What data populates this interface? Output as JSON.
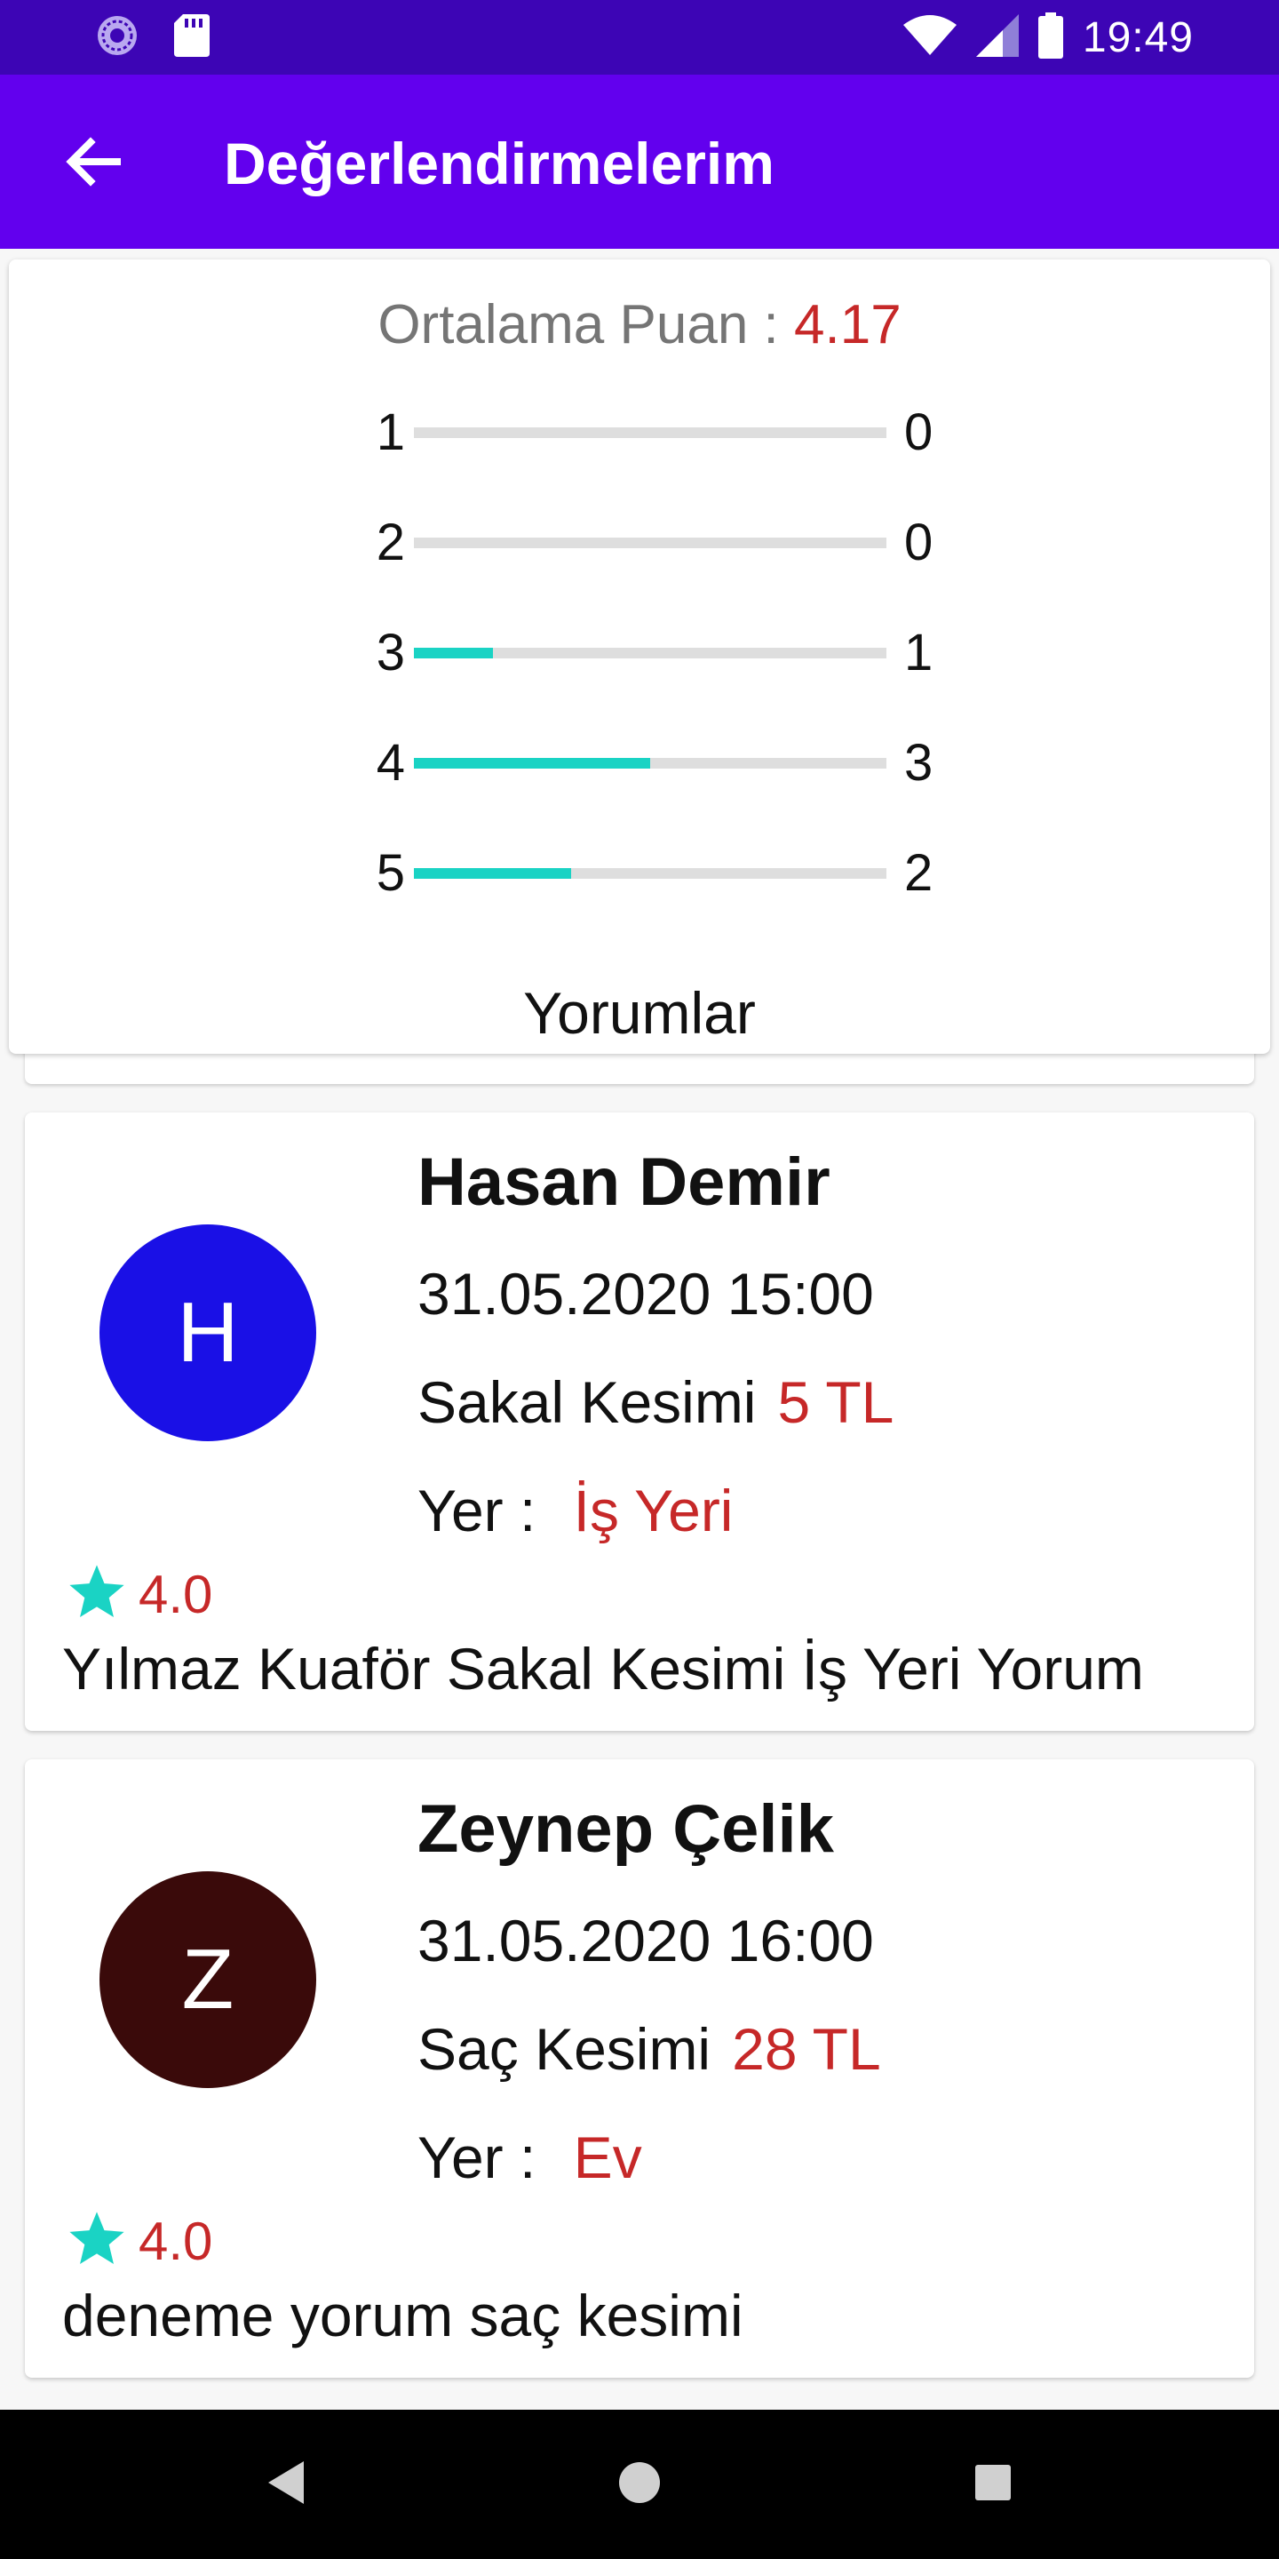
{
  "status_bar": {
    "time": "19:49",
    "icons": [
      "app-notification-icon",
      "sd-card-icon",
      "wifi-icon",
      "signal-icon",
      "battery-icon"
    ]
  },
  "app_bar": {
    "title": "Değerlendirmelerim",
    "back_icon": "arrow-back-icon"
  },
  "summary": {
    "average_label": "Ortalama Puan : ",
    "average_value": "4.17",
    "distribution": [
      {
        "star": "1",
        "count": "0",
        "fraction": 0.0
      },
      {
        "star": "2",
        "count": "0",
        "fraction": 0.0
      },
      {
        "star": "3",
        "count": "1",
        "fraction": 0.167
      },
      {
        "star": "4",
        "count": "3",
        "fraction": 0.5
      },
      {
        "star": "5",
        "count": "2",
        "fraction": 0.333
      }
    ],
    "comments_title": "Yorumlar"
  },
  "reviews": [
    {
      "initial": "H",
      "avatar_color": "#1a10e6",
      "name": "Hasan Demir",
      "date": "31.05.2020 15:00",
      "service": "Sakal Kesimi",
      "price": "5 TL",
      "place_label": "Yer : ",
      "place": "İş Yeri",
      "rating": "4.0",
      "comment": "Yılmaz Kuaför Sakal Kesimi İş  Yeri Yorum"
    },
    {
      "initial": "Z",
      "avatar_color": "#3a0a0a",
      "name": "Zeynep Çelik",
      "date": "31.05.2020 16:00",
      "service": "Saç Kesimi",
      "price": "28 TL",
      "place_label": "Yer : ",
      "place": "Ev",
      "rating": "4.0",
      "comment": "deneme yorum saç kesimi"
    }
  ],
  "colors": {
    "status_bar": "#3d05b5",
    "app_bar": "#6200ee",
    "accent_red": "#c62828",
    "bar_fill": "#1ad3c4",
    "star": "#1ad3c4"
  },
  "nav_bar": {
    "icons": [
      "back-triangle-icon",
      "home-circle-icon",
      "recents-square-icon"
    ]
  }
}
